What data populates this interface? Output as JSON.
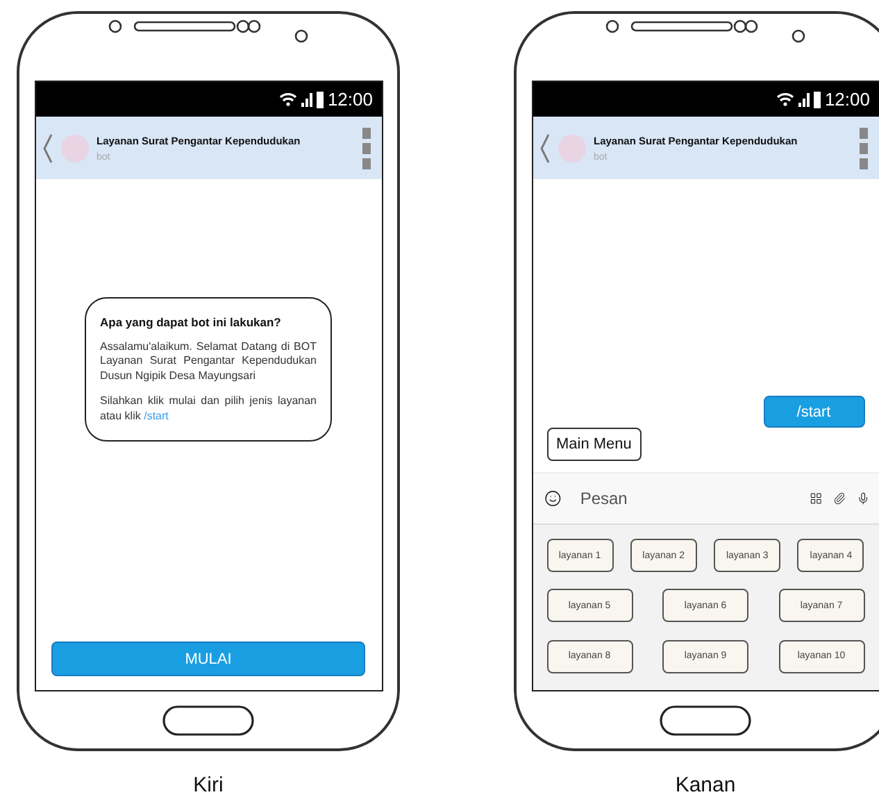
{
  "phones": [
    {
      "kind": "welcome",
      "caption": "Kiri",
      "status_time": "12:00",
      "chat": {
        "title": "Layanan Surat Pengantar Kependudukan",
        "subtitle": "bot"
      },
      "card": {
        "title": "Apa yang dapat bot ini lakukan?",
        "paragraphs": [
          "Assalamu'alaikum. Selamat Datang di BOT Layanan Surat Pengantar Kependudukan Dusun Ngipik Desa Mayungsari"
        ],
        "prompt": {
          "text": "Silahkan klik mulai dan pilih jenis layanan atau klik",
          "link": "/start"
        }
      },
      "action_button": "MULAI"
    },
    {
      "kind": "chat",
      "caption": "Kanan",
      "status_time": "12:00",
      "chat": {
        "title": "Layanan Surat Pengantar Kependudukan",
        "subtitle": "bot"
      },
      "sent_message": "/start",
      "menu_button": "Main Menu",
      "input": {
        "placeholder": "Pesan"
      },
      "keyboard_rows": [
        [
          "layanan 1",
          "layanan 2",
          "layanan 3",
          "layanan 4"
        ],
        [
          "layanan 5",
          "layanan 6",
          "layanan 7"
        ],
        [
          "layanan 8",
          "layanan 9",
          "layanan 10"
        ]
      ]
    }
  ]
}
